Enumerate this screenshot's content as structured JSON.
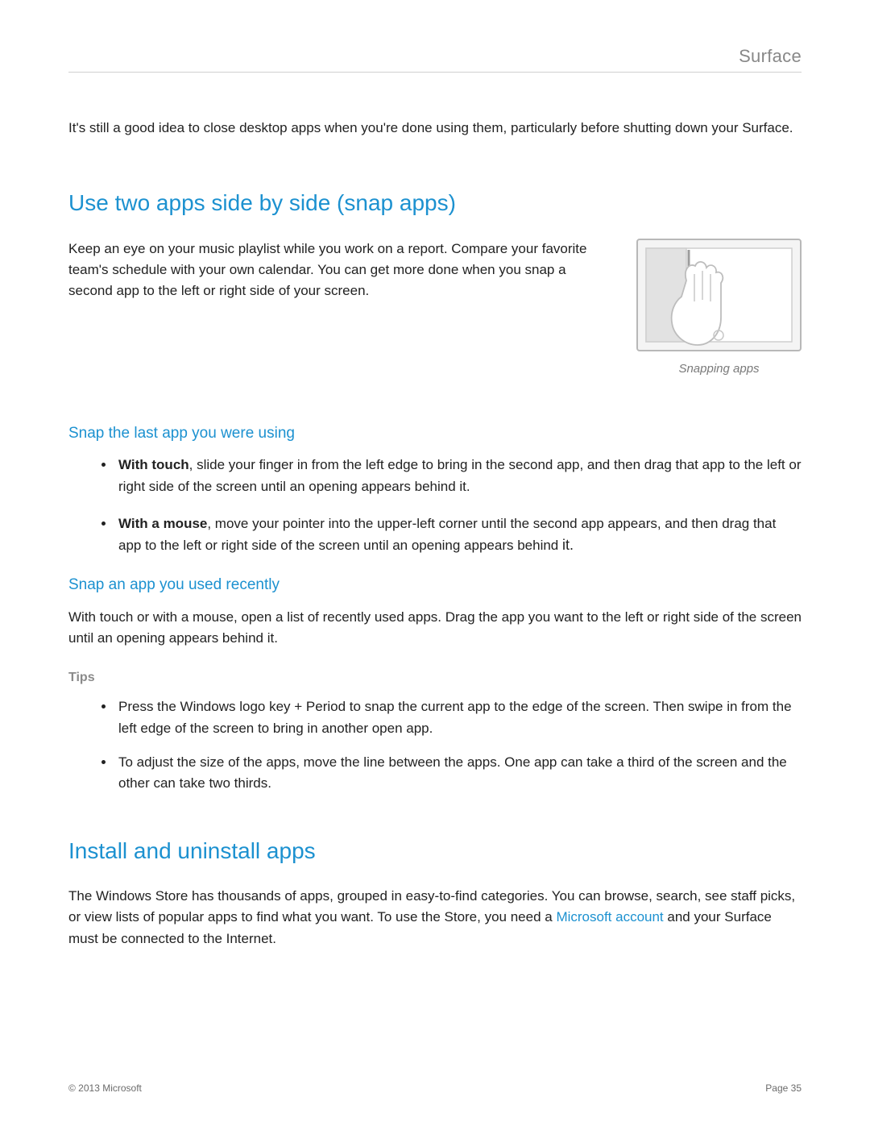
{
  "header": {
    "title": "Surface"
  },
  "intro": "It's still a good idea to close desktop apps when you're done using them, particularly before shutting down your Surface.",
  "snap": {
    "heading": "Use two apps side by side (snap apps)",
    "para": "Keep an eye on your music playlist while you work on a report. Compare your favorite team's schedule with your own calendar. You can get more done when you snap a second app to the left or right side of your screen.",
    "caption": "Snapping apps"
  },
  "snap_last": {
    "heading": "Snap the last app you were using",
    "touch_bold": "With touch",
    "touch_rest": ", slide your finger in from the left edge to bring in the second app, and then drag that app to the left or right side of the screen until an opening appears behind it.",
    "mouse_bold": "With a mouse",
    "mouse_rest": ", move your pointer into the upper-left corner until the second app appears, and then drag that app to the left or right side of the screen until an opening appears behind ",
    "mouse_tail": "it."
  },
  "snap_recent": {
    "heading": "Snap an app you used recently",
    "para": "With touch or with a mouse, open a list of recently used apps.  Drag the app you want to the left or right side of the screen until an opening appears behind it."
  },
  "tips": {
    "label": "Tips",
    "items": [
      "Press the Windows logo key + Period to snap the current app to the edge of the screen. Then swipe in from the left edge of the screen to bring in another open app.",
      "To adjust the size of the apps, move the line between the apps. One app can take a third of the screen and the other can take two thirds."
    ]
  },
  "install": {
    "heading": "Install and uninstall apps",
    "para_a": "The Windows Store has thousands of apps, grouped in easy-to-find categories. You can browse, search, see staff picks, or view lists of popular apps to find what you want. To use the Store, you need a ",
    "link": "Microsoft account",
    "para_b": " and your Surface must be connected to the Internet."
  },
  "footer": {
    "copyright": "© 2013 Microsoft",
    "page": "Page 35"
  }
}
